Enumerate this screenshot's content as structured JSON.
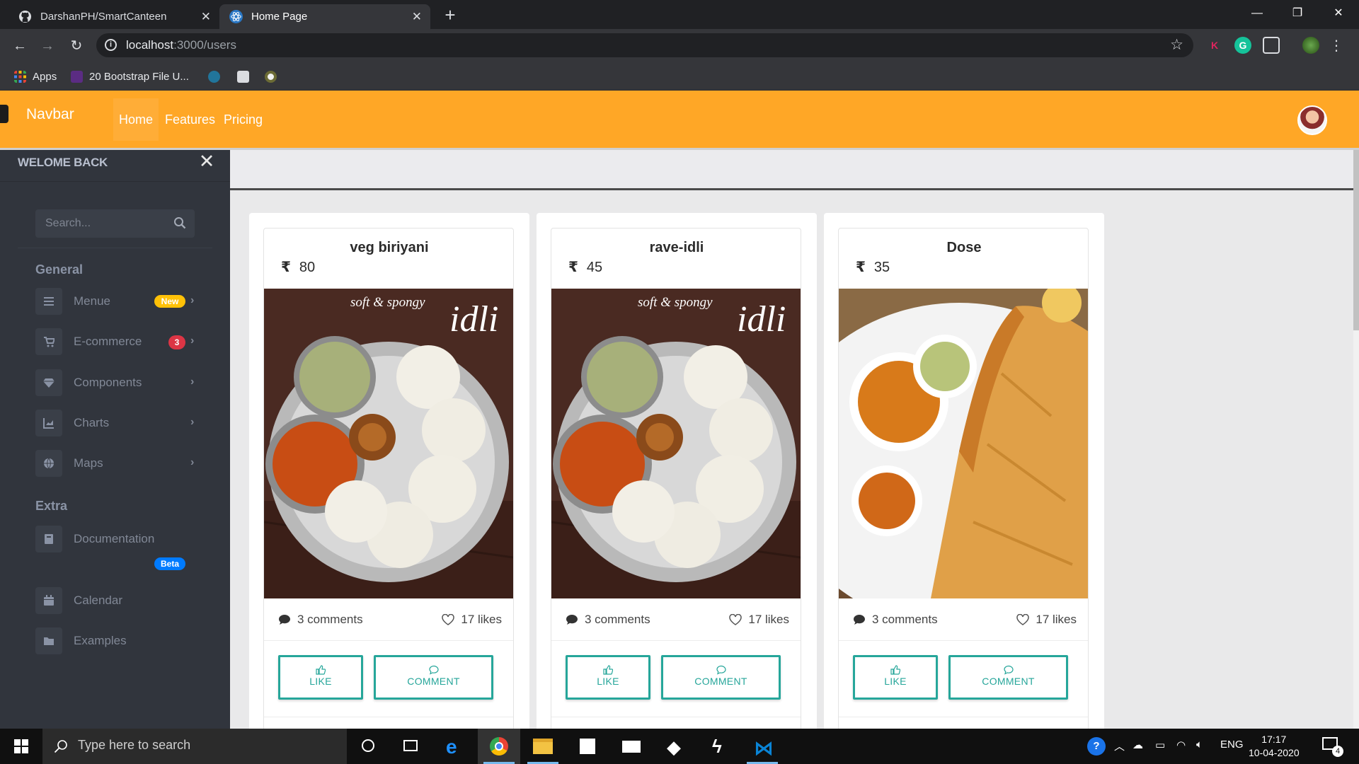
{
  "browser": {
    "tabs": [
      {
        "title": "DarshanPH/SmartCanteen",
        "active": false,
        "icon": "github-icon"
      },
      {
        "title": "Home Page",
        "active": true,
        "icon": "react-icon"
      }
    ],
    "url_host": "localhost",
    "url_path": ":3000/users",
    "bookmarks": [
      {
        "label": "Apps",
        "icon": "apps-grid-icon"
      },
      {
        "label": "20 Bootstrap File U...",
        "icon": "colorlib-icon"
      },
      {
        "label": "",
        "icon": "wordpress-icon"
      },
      {
        "label": "",
        "icon": "bookmark-store-icon"
      },
      {
        "label": "",
        "icon": "bookmark-circle-icon"
      }
    ],
    "extensions": [
      "K",
      "G"
    ]
  },
  "navbar": {
    "brand": "Navbar",
    "links": [
      {
        "label": "Home",
        "active": true
      },
      {
        "label": "Features",
        "active": false
      },
      {
        "label": "Pricing",
        "active": false
      }
    ],
    "color": "#ffa726"
  },
  "sidebar": {
    "title": "WELOME BACK",
    "search_placeholder": "Search...",
    "sections": [
      {
        "label": "General"
      },
      {
        "label": "Extra"
      }
    ],
    "items": [
      {
        "label": "Menue",
        "icon": "bars-icon",
        "badge": "New",
        "badge_color": "#ffc107",
        "chevron": true
      },
      {
        "label": "E-commerce",
        "icon": "cart-icon",
        "badge": "3",
        "badge_color": "#dc3545",
        "chevron": true
      },
      {
        "label": "Components",
        "icon": "gem-icon",
        "badge": "",
        "chevron": true
      },
      {
        "label": "Charts",
        "icon": "chart-area-icon",
        "badge": "",
        "chevron": true
      },
      {
        "label": "Maps",
        "icon": "globe-icon",
        "badge": "",
        "chevron": true
      },
      {
        "label": "Documentation",
        "icon": "book-icon",
        "badge": "Beta",
        "badge_color": "#007bff",
        "chevron": false
      },
      {
        "label": "Calendar",
        "icon": "calendar-icon",
        "badge": "",
        "chevron": false
      },
      {
        "label": "Examples",
        "icon": "folder-icon",
        "badge": "",
        "chevron": false
      }
    ]
  },
  "cards": [
    {
      "title": "veg biriyani",
      "currency": "₹",
      "price": "80",
      "image": "idli-plate",
      "comments": "3 comments",
      "likes": "17 likes",
      "like_label": "LIKE",
      "comment_label": "COMMENT"
    },
    {
      "title": "rave-idli",
      "currency": "₹",
      "price": "45",
      "image": "idli-plate",
      "comments": "3 comments",
      "likes": "17 likes",
      "like_label": "LIKE",
      "comment_label": "COMMENT"
    },
    {
      "title": "Dose",
      "currency": "₹",
      "price": "35",
      "image": "dosa-plate",
      "comments": "3 comments",
      "likes": "17 likes",
      "like_label": "LIKE",
      "comment_label": "COMMENT"
    }
  ],
  "image_text": {
    "tagline": "soft & spongy",
    "word": "idli"
  },
  "accent_color": "#26a69a",
  "taskbar": {
    "search_placeholder": "Type here to search",
    "language": "ENG",
    "time": "17:17",
    "date": "10-04-2020",
    "notifications": "4"
  }
}
